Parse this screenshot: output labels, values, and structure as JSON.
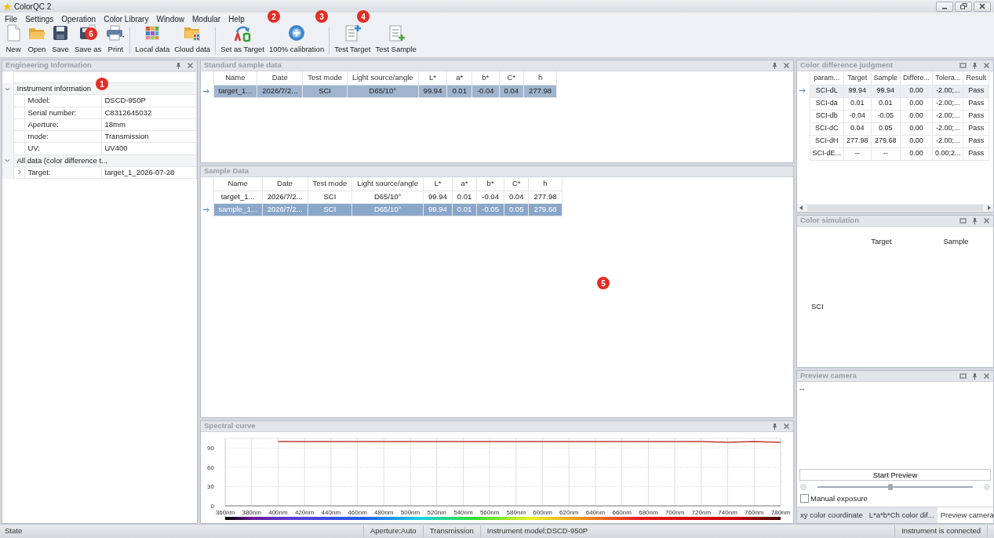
{
  "window": {
    "title": "ColorQC 2"
  },
  "menu": [
    "File",
    "Settings",
    "Operation",
    "Color Library",
    "Window",
    "Modular",
    "Help"
  ],
  "toolbar": [
    {
      "kind": "new",
      "label": "New"
    },
    {
      "kind": "open",
      "label": "Open"
    },
    {
      "kind": "save",
      "label": "Save"
    },
    {
      "kind": "saveas",
      "label": "Save as"
    },
    {
      "kind": "print",
      "label": "Print"
    },
    {
      "kind": "separator"
    },
    {
      "kind": "local",
      "label": "Local data"
    },
    {
      "kind": "cloud",
      "label": "Cloud data"
    },
    {
      "kind": "separator"
    },
    {
      "kind": "target",
      "label": "Set as Target"
    },
    {
      "kind": "calibration",
      "label": "100% calibration"
    },
    {
      "kind": "separator"
    },
    {
      "kind": "testtarget",
      "label": "Test Target"
    },
    {
      "kind": "testsample",
      "label": "Test Sample"
    }
  ],
  "engineering": {
    "title": "Engineering Information",
    "categories": [
      {
        "label": "Instrument information",
        "expanded": true,
        "children": [
          {
            "label": "Model:",
            "value": "DSCD-950P"
          },
          {
            "label": "Serial number:",
            "value": "C8312645032"
          },
          {
            "label": "Aperture:",
            "value": "18mm"
          },
          {
            "label": "mode:",
            "value": "Transmission"
          },
          {
            "label": "UV:",
            "value": "UV400"
          }
        ]
      },
      {
        "label": "All data (color difference t...",
        "expanded": true,
        "children": [
          {
            "label": "Target:",
            "value": "target_1_2026-07-28",
            "expanded": false
          }
        ]
      }
    ]
  },
  "standard": {
    "title": "Standard sample data",
    "focused": false,
    "columns": [
      "Name",
      "Date",
      "Test mode",
      "Light source/angle",
      "L*",
      "a*",
      "b*",
      "C*",
      "h"
    ],
    "rows": [
      {
        "selected": true,
        "cells": [
          "target_1...",
          "2026/7/2...",
          "SCI",
          "D65/10°",
          "99.94",
          "0.01",
          "-0.04",
          "0.04",
          "277.98"
        ]
      }
    ]
  },
  "samples": {
    "title": "Sample Data",
    "focused": true,
    "columns": [
      "Name",
      "Date",
      "Test mode",
      "Light source/angle",
      "L*",
      "a*",
      "b*",
      "C*",
      "h"
    ],
    "rows": [
      {
        "selected": false,
        "cells": [
          "target_1...",
          "2026/7/2...",
          "SCI",
          "D65/10°",
          "99.94",
          "0.01",
          "-0.04",
          "0.04",
          "277.98"
        ]
      },
      {
        "selected": true,
        "cells": [
          "sample_1...",
          "2026/7/2...",
          "SCI",
          "D65/10°",
          "99.94",
          "0.01",
          "-0.05",
          "0.05",
          "279.68"
        ]
      }
    ]
  },
  "spectral": {
    "title": "Spectral curve",
    "chart_data": {
      "type": "line",
      "grid": true,
      "categories": [
        "360nm",
        "380nm",
        "400nm",
        "420nm",
        "440nm",
        "460nm",
        "480nm",
        "500nm",
        "520nm",
        "540nm",
        "560nm",
        "580nm",
        "600nm",
        "620nm",
        "640nm",
        "660nm",
        "680nm",
        "700nm",
        "720nm",
        "740nm",
        "760nm",
        "780nm"
      ],
      "series": [
        {
          "color": "#c0393b",
          "values": [
            null,
            null,
            100,
            100,
            100,
            100,
            100,
            100,
            100,
            100,
            100,
            100,
            100,
            100,
            100,
            100,
            100,
            100,
            100,
            99,
            100,
            99
          ]
        }
      ],
      "ylim": [
        0,
        105
      ],
      "yticks": [
        0,
        30,
        60,
        90
      ]
    }
  },
  "judgment": {
    "title": "Color difference judgment",
    "columns": [
      "param...",
      "Target",
      "Sample",
      "Differe...",
      "Tolera...",
      "Result"
    ],
    "rows": [
      {
        "selected": true,
        "cells": [
          "SCI-dL",
          "99.94",
          "99.94",
          "0.00",
          "-2.00;...",
          "Pass"
        ]
      },
      {
        "selected": false,
        "cells": [
          "SCI-da",
          "0.01",
          "0.01",
          "0.00",
          "-2.00;...",
          "Pass"
        ]
      },
      {
        "selected": false,
        "cells": [
          "SCI-db",
          "-0.04",
          "-0.05",
          "0.00",
          "-2.00;...",
          "Pass"
        ]
      },
      {
        "selected": false,
        "cells": [
          "SCI-dC",
          "0.04",
          "0.05",
          "0.00",
          "-2.00;...",
          "Pass"
        ]
      },
      {
        "selected": false,
        "cells": [
          "SCI-dH",
          "277.98",
          "279.68",
          "0.00",
          "-2.00;...",
          "Pass"
        ]
      },
      {
        "selected": false,
        "cells": [
          "SCI-dE...",
          "--",
          "--",
          "0.00",
          "0.00;2...",
          "Pass"
        ]
      }
    ]
  },
  "simulation": {
    "title": "Color simulation",
    "columns": [
      "Target",
      "Sample"
    ],
    "rows": [
      "SCI"
    ]
  },
  "camera": {
    "title": "Preview camera",
    "readout": "--",
    "button": "Start Preview",
    "slider": {
      "level": 0.47
    },
    "manual_exposure": {
      "label": "Manual exposure",
      "checked": false
    },
    "tabs": [
      {
        "label": "xy color coordinate",
        "selected": false
      },
      {
        "label": "L*a*b*Ch color dif...",
        "selected": false
      },
      {
        "label": "Preview camera",
        "selected": true
      }
    ]
  },
  "status_bar": {
    "state": "State",
    "items": [
      "Aperture:Auto",
      "Transmission",
      "Instrument model:DSCD-950P"
    ],
    "connection": "Instrument is connected"
  },
  "annotations": [
    {
      "label": "1"
    },
    {
      "label": "2"
    },
    {
      "label": "3"
    },
    {
      "label": "4"
    },
    {
      "label": "5"
    },
    {
      "label": "6"
    }
  ]
}
